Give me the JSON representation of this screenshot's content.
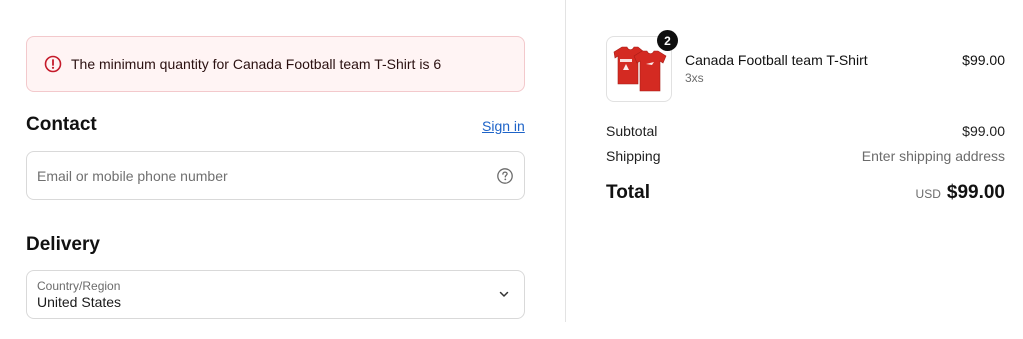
{
  "alert": {
    "message": "The minimum quantity for Canada Football team T-Shirt is 6",
    "icon": "error-circle-icon",
    "color": "#c51a2a"
  },
  "contact": {
    "heading": "Contact",
    "signin_label": "Sign in",
    "email_placeholder": "Email or mobile phone number",
    "email_value": "",
    "help_icon": "question-circle-icon"
  },
  "delivery": {
    "heading": "Delivery",
    "country_label": "Country/Region",
    "country_value": "United States",
    "chevron_icon": "chevron-down-icon"
  },
  "cart": {
    "items": [
      {
        "name": "Canada Football team T-Shirt",
        "variant": "3xs",
        "price": "$99.00",
        "quantity": "2",
        "image_icon": "red-tshirt-product-image"
      }
    ]
  },
  "summary": {
    "subtotal_label": "Subtotal",
    "subtotal_value": "$99.00",
    "shipping_label": "Shipping",
    "shipping_value": "Enter shipping address",
    "total_label": "Total",
    "currency": "USD",
    "total_value": "$99.00"
  },
  "colors": {
    "link": "#1d63c8",
    "alert_bg": "#fff4f4",
    "alert_border": "#f3c9cc",
    "product_red": "#d42a22"
  }
}
